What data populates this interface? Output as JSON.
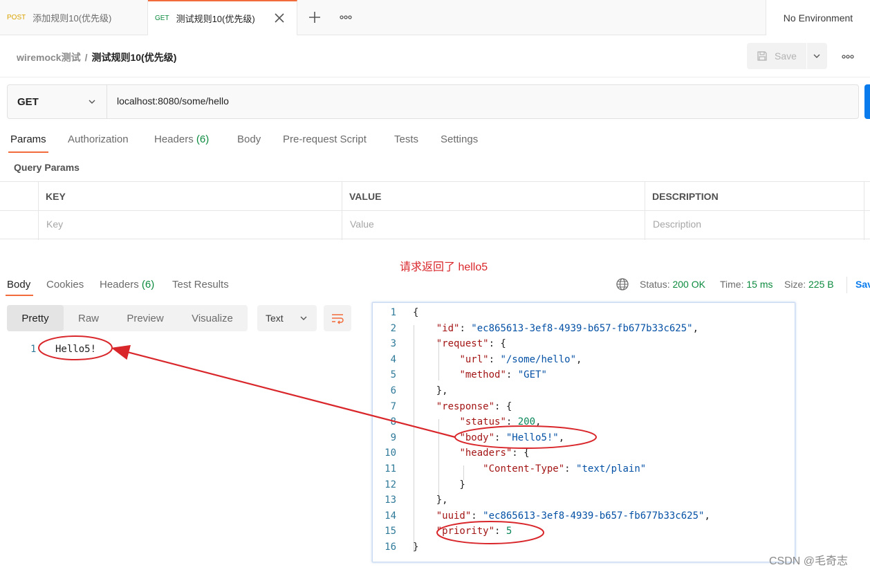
{
  "tabs": [
    {
      "method": "POST",
      "name": "添加规则10(优先级)"
    },
    {
      "method": "GET",
      "name": "测试规则10(优先级)"
    }
  ],
  "environment": "No Environment",
  "breadcrumb": {
    "collection": "wiremock测试",
    "separator": "/",
    "request": "测试规则10(优先级)"
  },
  "save_label": "Save",
  "request": {
    "method": "GET",
    "url": "localhost:8080/some/hello"
  },
  "request_tabs": {
    "params": "Params",
    "authorization": "Authorization",
    "headers": "Headers",
    "headers_count": "(6)",
    "body": "Body",
    "prerequest": "Pre-request Script",
    "tests": "Tests",
    "settings": "Settings"
  },
  "query_params": {
    "title": "Query Params",
    "columns": [
      "KEY",
      "VALUE",
      "DESCRIPTION"
    ],
    "placeholders": [
      "Key",
      "Value",
      "Description"
    ]
  },
  "annotation": "请求返回了 hello5",
  "response_tabs": {
    "body": "Body",
    "cookies": "Cookies",
    "headers": "Headers",
    "headers_count": "(6)",
    "test_results": "Test Results"
  },
  "status": {
    "status_label": "Status:",
    "status_value": "200 OK",
    "time_label": "Time:",
    "time_value": "15 ms",
    "size_label": "Size:",
    "size_value": "225 B",
    "save_response": "Sav"
  },
  "view_modes": [
    "Pretty",
    "Raw",
    "Preview",
    "Visualize"
  ],
  "active_view": "Pretty",
  "format": "Text",
  "response_body": {
    "line": "1",
    "text": "Hello5!"
  },
  "json_lines": [
    {
      "n": "1",
      "text": "{"
    },
    {
      "n": "2",
      "text": "    \"id\": \"ec865613-3ef8-4939-b657-fb677b33c625\","
    },
    {
      "n": "3",
      "text": "    \"request\": {"
    },
    {
      "n": "4",
      "text": "        \"url\": \"/some/hello\","
    },
    {
      "n": "5",
      "text": "        \"method\": \"GET\""
    },
    {
      "n": "6",
      "text": "    },"
    },
    {
      "n": "7",
      "text": "    \"response\": {"
    },
    {
      "n": "8",
      "text": "        \"status\": 200,"
    },
    {
      "n": "9",
      "text": "        \"body\": \"Hello5!\","
    },
    {
      "n": "10",
      "text": "        \"headers\": {"
    },
    {
      "n": "11",
      "text": "            \"Content-Type\": \"text/plain\""
    },
    {
      "n": "12",
      "text": "        }"
    },
    {
      "n": "13",
      "text": "    },"
    },
    {
      "n": "14",
      "text": "    \"uuid\": \"ec865613-3ef8-4939-b657-fb677b33c625\","
    },
    {
      "n": "15",
      "text": "    \"priority\": 5"
    },
    {
      "n": "16",
      "text": "}"
    }
  ],
  "watermark": "CSDN @毛奇志",
  "colors": {
    "accent": "#f26b3a",
    "get": "#0b8a3e",
    "post": "#d9a300",
    "annotation": "#d9262a",
    "send": "#097bed"
  }
}
